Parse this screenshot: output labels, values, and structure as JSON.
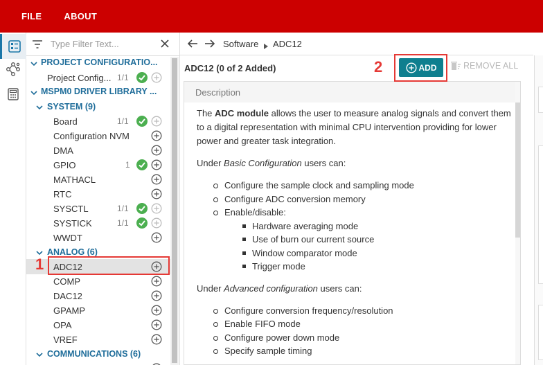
{
  "menu": {
    "file": "FILE",
    "about": "ABOUT"
  },
  "filter": {
    "placeholder": "Type Filter Text..."
  },
  "tree": {
    "project_config_header": "PROJECT CONFIGURATIO...",
    "project_config_item": {
      "label": "Project Config...",
      "count": "1/1"
    },
    "driver_lib_header": "MSPM0 DRIVER LIBRARY ...",
    "system_header": "SYSTEM (9)",
    "system_items": [
      {
        "label": "Board",
        "count": "1/1"
      },
      {
        "label": "Configuration NVM",
        "count": ""
      },
      {
        "label": "DMA",
        "count": ""
      },
      {
        "label": "GPIO",
        "count": "1"
      },
      {
        "label": "MATHACL",
        "count": ""
      },
      {
        "label": "RTC",
        "count": ""
      },
      {
        "label": "SYSCTL",
        "count": "1/1"
      },
      {
        "label": "SYSTICK",
        "count": "1/1"
      },
      {
        "label": "WWDT",
        "count": ""
      }
    ],
    "analog_header": "ANALOG (6)",
    "analog_items": [
      {
        "label": "ADC12"
      },
      {
        "label": "COMP"
      },
      {
        "label": "DAC12"
      },
      {
        "label": "GPAMP"
      },
      {
        "label": "OPA"
      },
      {
        "label": "VREF"
      }
    ],
    "comm_header": "COMMUNICATIONS (6)"
  },
  "annotations": {
    "step1": "1",
    "step2": "2"
  },
  "breadcrumb": {
    "parent": "Software",
    "current": "ADC12"
  },
  "module": {
    "title": "ADC12 (0 of 2 Added)",
    "add_label": "ADD",
    "remove_all_label": "REMOVE ALL"
  },
  "description": {
    "heading": "Description",
    "intro_bold": "ADC module",
    "intro_pre": "The ",
    "intro_post": " allows the user to measure analog signals and convert them to a digital representation with minimal CPU intervention providing for lower power and greater task integration.",
    "basic_pre": "Under ",
    "basic_em": "Basic Configuration",
    "basic_post": " users can:",
    "basic_items": [
      "Configure the sample clock and sampling mode",
      "Configure ADC conversion memory",
      "Enable/disable:"
    ],
    "basic_sub_items": [
      "Hardware averaging mode",
      "Use of burn our current source",
      "Window comparator mode",
      "Trigger mode"
    ],
    "adv_pre": "Under ",
    "adv_em": "Advanced configuration",
    "adv_post": " users can:",
    "adv_items": [
      "Configure conversion frequency/resolution",
      "Enable FIFO mode",
      "Configure power down mode",
      "Specify sample timing"
    ]
  },
  "colors": {
    "topbar": "#cc0000",
    "accent_blue": "#1f6d9a",
    "add_button": "#0f7f8f",
    "ok_green": "#4caf50",
    "highlight_red": "#e53935"
  }
}
